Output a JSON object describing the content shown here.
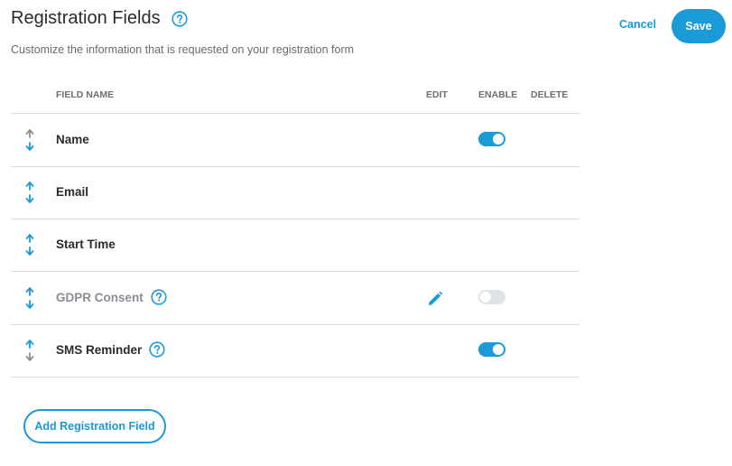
{
  "header": {
    "title": "Registration Fields",
    "subtitle": "Customize the information that is requested on your registration form",
    "cancel_label": "Cancel",
    "save_label": "Save"
  },
  "columns": {
    "field_name": "FIELD NAME",
    "edit": "EDIT",
    "enable": "ENABLE",
    "delete": "DELETE"
  },
  "fields": [
    {
      "label": "Name",
      "help": false,
      "editable": false,
      "toggle": "on",
      "dimmed": false
    },
    {
      "label": "Email",
      "help": false,
      "editable": false,
      "toggle": null,
      "dimmed": false
    },
    {
      "label": "Start Time",
      "help": false,
      "editable": false,
      "toggle": null,
      "dimmed": false
    },
    {
      "label": "GDPR Consent",
      "help": true,
      "editable": true,
      "toggle": "off",
      "dimmed": true
    },
    {
      "label": "SMS Reminder",
      "help": true,
      "editable": false,
      "toggle": "on",
      "dimmed": false
    }
  ],
  "add_button_label": "Add Registration Field",
  "colors": {
    "accent": "#1a9bd7",
    "text": "#2b2b2b",
    "muted": "#6b6b6b",
    "divider": "#dcdcdc",
    "toggle_off": "#dfe3e6"
  },
  "icons": {
    "help": "help-circle-icon",
    "drag": "drag-handle-icon",
    "edit": "pencil-icon"
  }
}
